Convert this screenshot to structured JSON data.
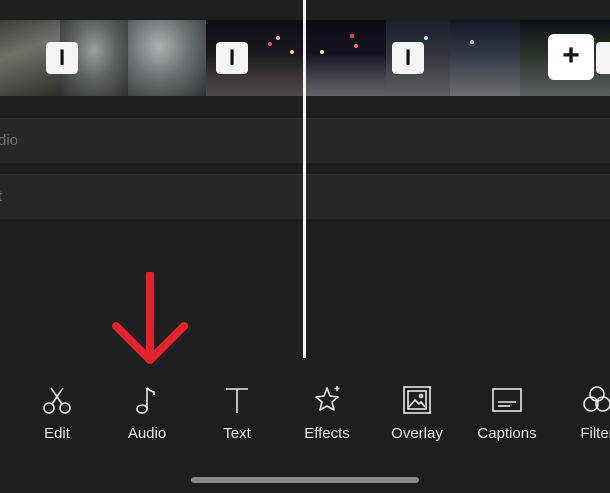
{
  "timeline": {
    "transition_glyph": "I",
    "add_clip_glyph": "+"
  },
  "tracks": [
    {
      "label": "dio"
    },
    {
      "label": "t"
    }
  ],
  "toolbar": {
    "items": [
      {
        "label": "Edit",
        "icon": "scissors-icon"
      },
      {
        "label": "Audio",
        "icon": "music-note-icon"
      },
      {
        "label": "Text",
        "icon": "text-icon"
      },
      {
        "label": "Effects",
        "icon": "sparkle-star-icon"
      },
      {
        "label": "Overlay",
        "icon": "picture-overlay-icon"
      },
      {
        "label": "Captions",
        "icon": "captions-icon"
      },
      {
        "label": "Filter",
        "icon": "filter-circles-icon"
      }
    ]
  },
  "colors": {
    "background": "#1e1e1f",
    "track_row": "#272728",
    "annotation_arrow": "#e4222c",
    "playhead": "#f2f2f2"
  }
}
